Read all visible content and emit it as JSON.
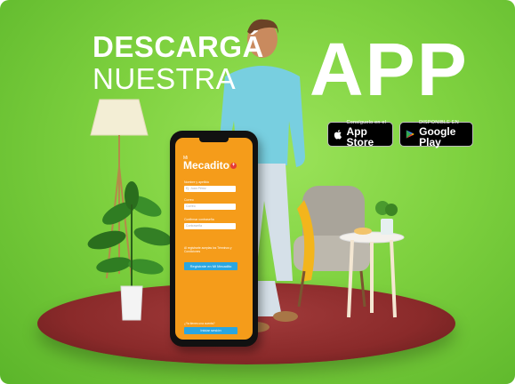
{
  "headline": {
    "line1": "DESCARGÁ",
    "line2": "NUESTRA",
    "big_word": "APP"
  },
  "badges": {
    "apple": {
      "small": "Consíguelo en el",
      "big": "App Store"
    },
    "google": {
      "small": "DISPONIBLE EN",
      "big": "Google Play"
    }
  },
  "phone": {
    "brand_small": "Mi",
    "brand": "Mecadito",
    "brand_plus": "+",
    "field1_label": "Nombre y apellido",
    "field1_placeholder": "Ej: Juan Pérez",
    "field2_label": "Correo",
    "field2_placeholder": "Correo",
    "field3_label": "Confirmar contraseña",
    "field3_placeholder": "Contraseña",
    "terms": "Al registrarte aceptas los Términos y Condiciones",
    "cta": "Regístrate en Mi Mecadito",
    "ask": "¿Ya tienes una cuenta?",
    "login": "Iniciar sesión"
  },
  "colors": {
    "background": "#7ed13f",
    "floor": "#8a2a2a",
    "screen": "#f59c1a",
    "button": "#2aa6e0"
  }
}
